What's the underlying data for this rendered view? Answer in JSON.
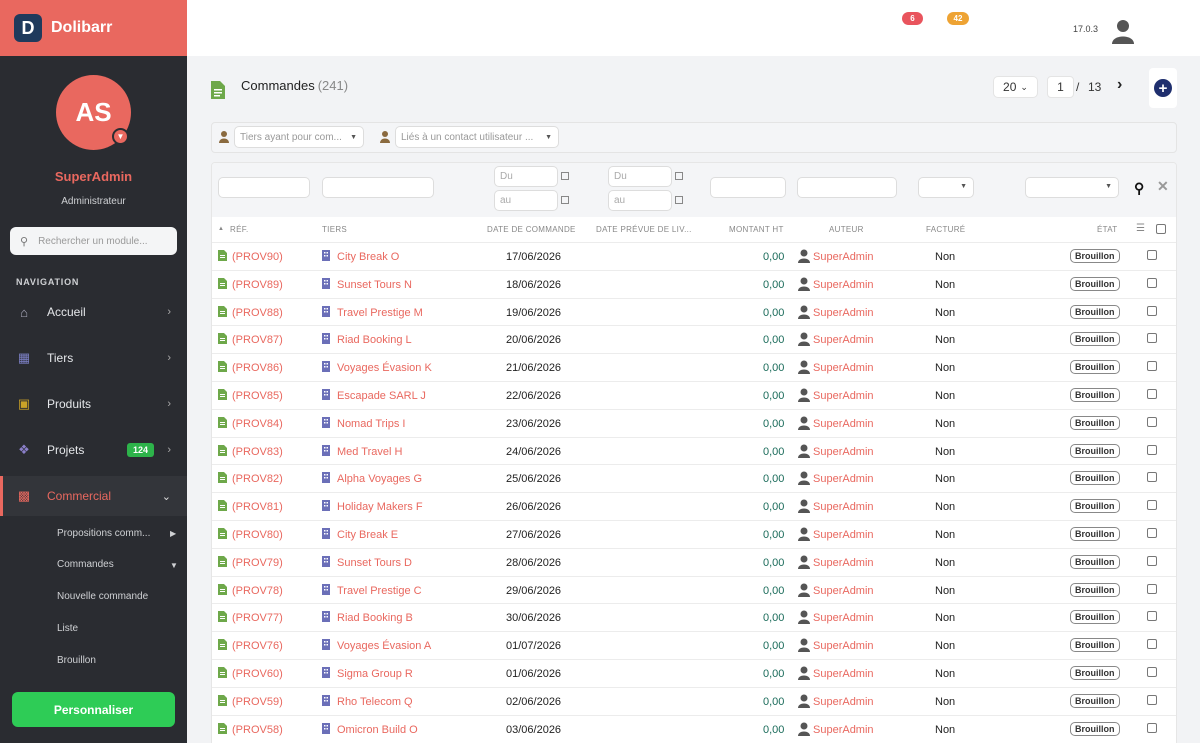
{
  "app": {
    "name": "Dolibarr",
    "logo_letter": "D",
    "version": "17.0.3"
  },
  "user": {
    "initials": "AS",
    "name": "SuperAdmin",
    "role": "Administrateur"
  },
  "sidebar": {
    "search_placeholder": "Rechercher un module...",
    "nav_heading": "NAVIGATION",
    "items": [
      {
        "label": "Accueil",
        "icon": "home-icon"
      },
      {
        "label": "Tiers",
        "icon": "building-icon"
      },
      {
        "label": "Produits",
        "icon": "box-icon"
      },
      {
        "label": "Projets",
        "icon": "project-icon",
        "badge": "124"
      },
      {
        "label": "Commercial",
        "icon": "briefcase-icon",
        "active": true
      }
    ],
    "subitems": [
      "Propositions comm...",
      "Commandes",
      "Nouvelle commande",
      "Liste",
      "Brouillon"
    ],
    "customize_label": "Personnaliser"
  },
  "topbar": {
    "badge_red": "6",
    "badge_orange": "42"
  },
  "page": {
    "title": "Commandes",
    "count": "(241)",
    "limit": "20",
    "current_page": "1",
    "total_pages": "13",
    "filter_thirdparty_placeholder": "Tiers ayant pour com...",
    "filter_contact_placeholder": "Liés à un contact utilisateur ...",
    "date_from_placeholder": "Du",
    "date_to_placeholder": "au"
  },
  "table": {
    "headers": [
      "RÉF.",
      "TIERS",
      "DATE DE COMMANDE",
      "DATE PRÉVUE DE LIV...",
      "MONTANT HT",
      "AUTEUR",
      "FACTURÉ",
      "ÉTAT"
    ],
    "rows": [
      {
        "ref": "(PROV90)",
        "tiers": "City Break O",
        "date": "17/06/2026",
        "amount": "0,00",
        "author": "SuperAdmin",
        "billed": "Non",
        "status": "Brouillon"
      },
      {
        "ref": "(PROV89)",
        "tiers": "Sunset Tours N",
        "date": "18/06/2026",
        "amount": "0,00",
        "author": "SuperAdmin",
        "billed": "Non",
        "status": "Brouillon"
      },
      {
        "ref": "(PROV88)",
        "tiers": "Travel Prestige M",
        "date": "19/06/2026",
        "amount": "0,00",
        "author": "SuperAdmin",
        "billed": "Non",
        "status": "Brouillon"
      },
      {
        "ref": "(PROV87)",
        "tiers": "Riad Booking L",
        "date": "20/06/2026",
        "amount": "0,00",
        "author": "SuperAdmin",
        "billed": "Non",
        "status": "Brouillon"
      },
      {
        "ref": "(PROV86)",
        "tiers": "Voyages Évasion K",
        "date": "21/06/2026",
        "amount": "0,00",
        "author": "SuperAdmin",
        "billed": "Non",
        "status": "Brouillon"
      },
      {
        "ref": "(PROV85)",
        "tiers": "Escapade SARL J",
        "date": "22/06/2026",
        "amount": "0,00",
        "author": "SuperAdmin",
        "billed": "Non",
        "status": "Brouillon"
      },
      {
        "ref": "(PROV84)",
        "tiers": "Nomad Trips I",
        "date": "23/06/2026",
        "amount": "0,00",
        "author": "SuperAdmin",
        "billed": "Non",
        "status": "Brouillon"
      },
      {
        "ref": "(PROV83)",
        "tiers": "Med Travel H",
        "date": "24/06/2026",
        "amount": "0,00",
        "author": "SuperAdmin",
        "billed": "Non",
        "status": "Brouillon"
      },
      {
        "ref": "(PROV82)",
        "tiers": "Alpha Voyages G",
        "date": "25/06/2026",
        "amount": "0,00",
        "author": "SuperAdmin",
        "billed": "Non",
        "status": "Brouillon"
      },
      {
        "ref": "(PROV81)",
        "tiers": "Holiday Makers F",
        "date": "26/06/2026",
        "amount": "0,00",
        "author": "SuperAdmin",
        "billed": "Non",
        "status": "Brouillon"
      },
      {
        "ref": "(PROV80)",
        "tiers": "City Break E",
        "date": "27/06/2026",
        "amount": "0,00",
        "author": "SuperAdmin",
        "billed": "Non",
        "status": "Brouillon"
      },
      {
        "ref": "(PROV79)",
        "tiers": "Sunset Tours D",
        "date": "28/06/2026",
        "amount": "0,00",
        "author": "SuperAdmin",
        "billed": "Non",
        "status": "Brouillon"
      },
      {
        "ref": "(PROV78)",
        "tiers": "Travel Prestige C",
        "date": "29/06/2026",
        "amount": "0,00",
        "author": "SuperAdmin",
        "billed": "Non",
        "status": "Brouillon"
      },
      {
        "ref": "(PROV77)",
        "tiers": "Riad Booking B",
        "date": "30/06/2026",
        "amount": "0,00",
        "author": "SuperAdmin",
        "billed": "Non",
        "status": "Brouillon"
      },
      {
        "ref": "(PROV76)",
        "tiers": "Voyages Évasion A",
        "date": "01/07/2026",
        "amount": "0,00",
        "author": "SuperAdmin",
        "billed": "Non",
        "status": "Brouillon"
      },
      {
        "ref": "(PROV60)",
        "tiers": "Sigma Group R",
        "date": "01/06/2026",
        "amount": "0,00",
        "author": "SuperAdmin",
        "billed": "Non",
        "status": "Brouillon"
      },
      {
        "ref": "(PROV59)",
        "tiers": "Rho Telecom Q",
        "date": "02/06/2026",
        "amount": "0,00",
        "author": "SuperAdmin",
        "billed": "Non",
        "status": "Brouillon"
      },
      {
        "ref": "(PROV58)",
        "tiers": "Omicron Build O",
        "date": "03/06/2026",
        "amount": "0,00",
        "author": "SuperAdmin",
        "billed": "Non",
        "status": "Brouillon"
      }
    ]
  },
  "colors": {
    "accent": "#e9685f",
    "sidebar_bg": "#2a2c31",
    "success": "#2ecc56",
    "amount": "#1a6b5a"
  }
}
